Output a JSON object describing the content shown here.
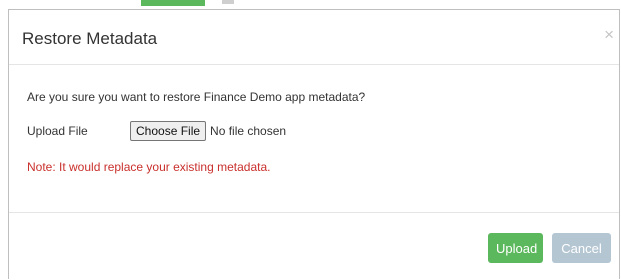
{
  "modal": {
    "title": "Restore Metadata",
    "close_symbol": "×",
    "close_icon": "close-icon"
  },
  "body": {
    "question": "Are you sure you want to restore Finance Demo app metadata?",
    "upload_label": "Upload File",
    "choose_file_label": "Choose File",
    "file_status": "No file chosen",
    "note": "Note: It would replace your existing metadata."
  },
  "footer": {
    "upload_label": "Upload",
    "cancel_label": "Cancel"
  },
  "colors": {
    "upload_button": "#5cb85c",
    "cancel_button": "#b5c6d3",
    "note_text": "#c9302c"
  }
}
